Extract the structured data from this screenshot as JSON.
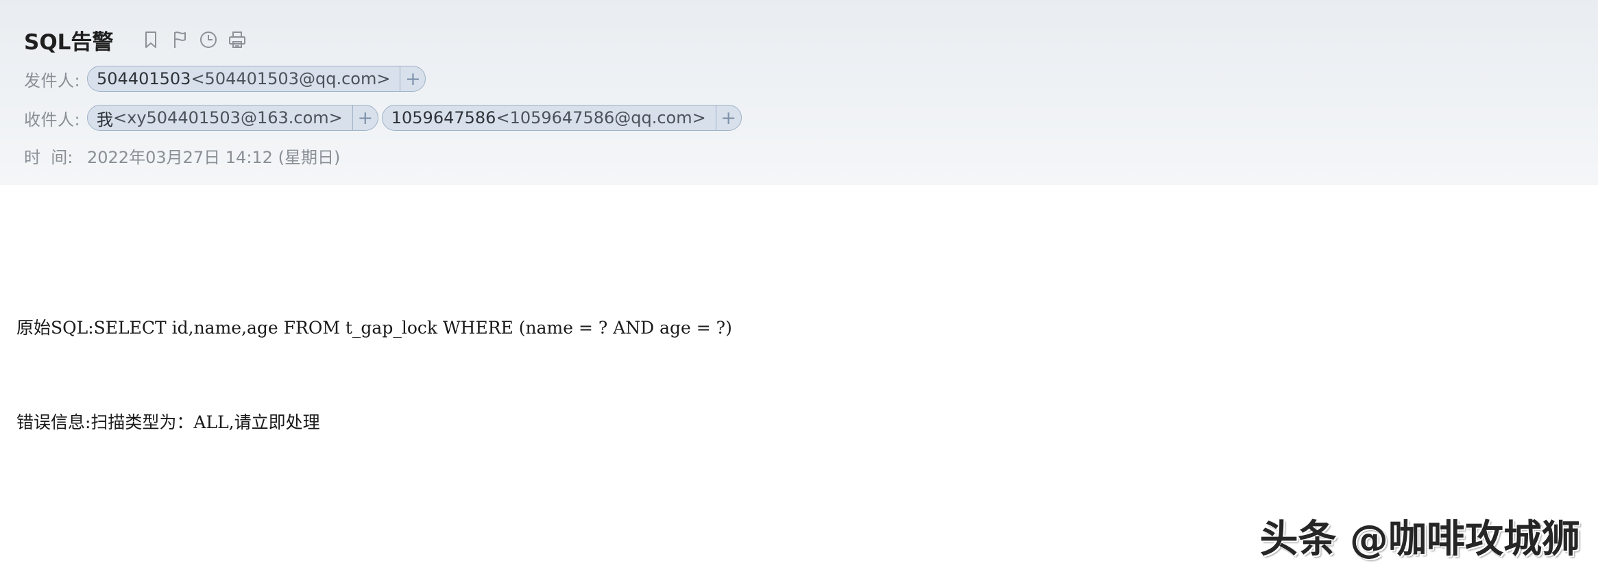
{
  "email": {
    "subject": "SQL告警",
    "toolbar": [
      {
        "icon": "bookmark-icon"
      },
      {
        "icon": "flag-icon"
      },
      {
        "icon": "clock-icon"
      },
      {
        "icon": "print-icon"
      }
    ],
    "sender": {
      "label": "发件人:",
      "chips": [
        {
          "name": "504401503",
          "address": "<504401503@qq.com>",
          "add_label": "+"
        }
      ]
    },
    "recipient": {
      "label": "收件人:",
      "chips": [
        {
          "name": "我",
          "address": "<xy504401503@163.com>",
          "add_label": "+"
        },
        {
          "name": "1059647586",
          "address": "<1059647586@qq.com>",
          "add_label": "+"
        }
      ]
    },
    "time": {
      "label": "时  间:",
      "value": "2022年03月27日 14:12 (星期日)"
    },
    "body_lines": [
      "原始SQL:SELECT id,name,age FROM t_gap_lock WHERE (name = ? AND age = ?)",
      "错误信息:扫描类型为：ALL,请立即处理"
    ]
  },
  "watermark": "头条 @咖啡攻城狮",
  "colors": {
    "header_bg": "#eef1f4",
    "chip_bg": "#d7e0eb",
    "chip_border": "#9fb2c8",
    "label_gray": "#8a8f96"
  }
}
